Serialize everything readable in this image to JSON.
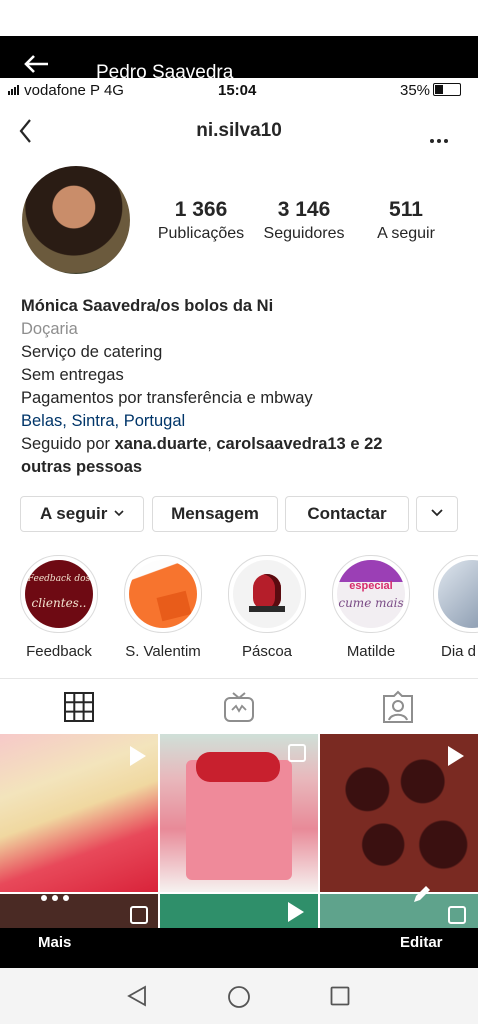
{
  "outer": {
    "contact_name": "Pedro Saavedra",
    "more_label": "Mais",
    "edit_label": "Editar"
  },
  "status_bar": {
    "carrier": "vodafone P  4G",
    "time": "15:04",
    "battery": "35%"
  },
  "profile": {
    "username": "ni.silva10",
    "stats": [
      {
        "value": "1 366",
        "label": "Publicações"
      },
      {
        "value": "3 146",
        "label": "Seguidores"
      },
      {
        "value": "511",
        "label": "A seguir"
      }
    ],
    "full_name": "Mónica Saavedra/os bolos da Ni",
    "category": "Doçaria",
    "bio_lines": [
      "Serviço de catering",
      "Sem entregas",
      "Pagamentos por transferência e mbway"
    ],
    "location": "Belas, Sintra, Portugal",
    "followed_by": {
      "prefix": "Seguido por ",
      "user1": "xana.duarte",
      "sep": ", ",
      "user2": "carolsaavedra13",
      "suffix": " e 22",
      "line2": "outras pessoas"
    }
  },
  "buttons": {
    "following": "A seguir",
    "message": "Mensagem",
    "contact": "Contactar"
  },
  "highlights": [
    {
      "label": "Feedback",
      "cover_text_1": "Feedback dos",
      "cover_text_2": "clientes..",
      "color": "#6e0a13"
    },
    {
      "label": "S. Valentim",
      "color": "#f26722"
    },
    {
      "label": "Páscoa",
      "color": "#b51e2a"
    },
    {
      "label": "Matilde",
      "cover_text_1": "especial",
      "cover_text_2": "cume mais",
      "color": "#9b3fb5"
    },
    {
      "label": "Dia d",
      "color": "#5c6f8a"
    }
  ],
  "tabs": [
    {
      "icon": "grid-icon"
    },
    {
      "icon": "igtv-icon"
    },
    {
      "icon": "tagged-icon"
    }
  ],
  "colors": {
    "link": "#003569",
    "secondary": "#8e8e8e",
    "border": "#dbdbdb"
  }
}
